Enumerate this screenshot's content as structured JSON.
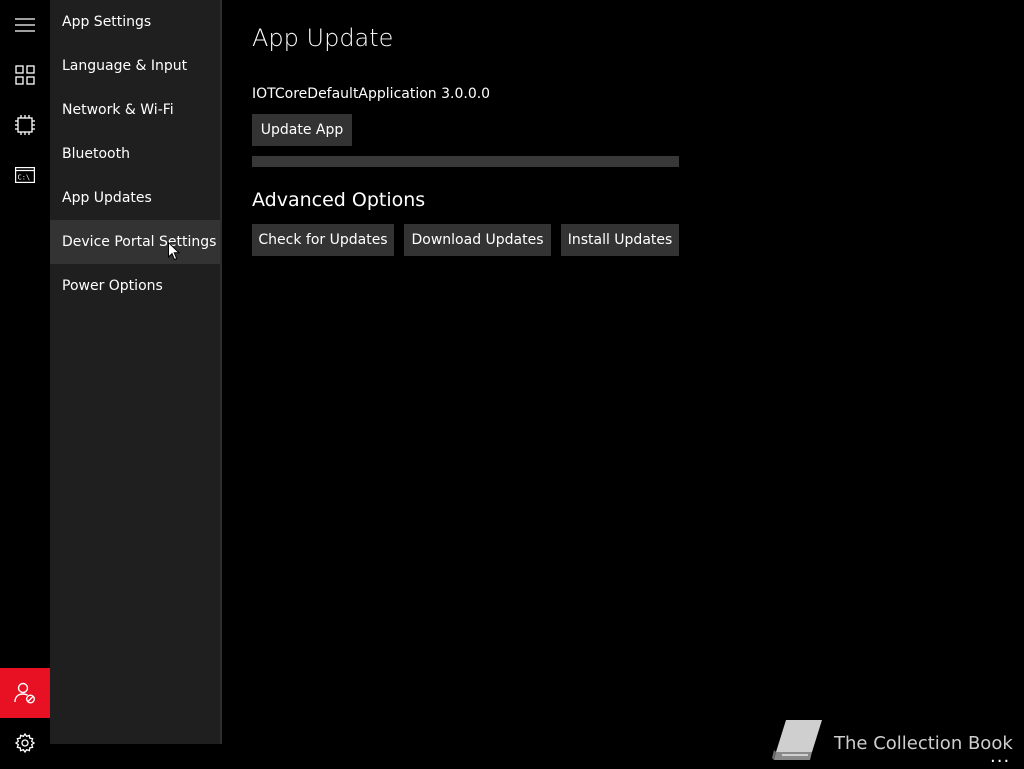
{
  "rail": {
    "icons": [
      "hamburger-menu-icon",
      "tiles-icon",
      "device-chip-icon",
      "command-prompt-icon",
      "user-blocked-icon",
      "gear-icon"
    ],
    "accent_color": "#e81123"
  },
  "sidebar": {
    "items": [
      {
        "label": "App Settings"
      },
      {
        "label": "Language & Input"
      },
      {
        "label": "Network & Wi-Fi"
      },
      {
        "label": "Bluetooth"
      },
      {
        "label": "App Updates"
      },
      {
        "label": "Device Portal Settings"
      },
      {
        "label": "Power Options"
      }
    ],
    "hovered_item": "Device Portal Settings"
  },
  "main": {
    "title": "App Update",
    "app_version": "IOTCoreDefaultApplication 3.0.0.0",
    "update_button": "Update App",
    "progress": 0,
    "advanced_title": "Advanced Options",
    "advanced_buttons": {
      "check": "Check for Updates",
      "download": "Download Updates",
      "install": "Install Updates"
    }
  },
  "watermark": {
    "text": "The Collection Book",
    "icon": "book-icon"
  },
  "more_button": {
    "label": "..."
  }
}
